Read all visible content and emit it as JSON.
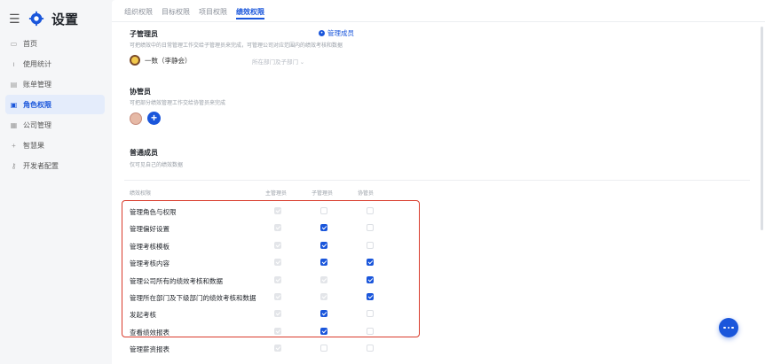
{
  "app": {
    "title": "设置"
  },
  "sidebar": {
    "items": [
      {
        "label": "首页",
        "icon": "home-icon"
      },
      {
        "label": "使用统计",
        "icon": "chart-icon"
      },
      {
        "label": "账单管理",
        "icon": "bill-icon"
      },
      {
        "label": "角色权限",
        "icon": "role-icon",
        "active": true
      },
      {
        "label": "公司管理",
        "icon": "company-icon"
      },
      {
        "label": "智慧果",
        "icon": "plus-icon"
      },
      {
        "label": "开发者配置",
        "icon": "key-icon"
      }
    ]
  },
  "tabs": [
    {
      "label": "组织权限"
    },
    {
      "label": "目标权限"
    },
    {
      "label": "项目权限"
    },
    {
      "label": "绩效权限",
      "active": true
    }
  ],
  "sub_admin": {
    "title": "子管理员",
    "desc": "可把绩效中的日常管理工作交给子管理员来完成，可管理公司对应范围内的绩效考核和数据",
    "manage_label": "管理成员",
    "member_name": "一数（李静会）",
    "scope_label": "所在部门及子部门 ⌄"
  },
  "assistant": {
    "title": "协管员",
    "desc": "可把部分绩效管理工作交给协管员来完成",
    "add_label": "+"
  },
  "normal": {
    "title": "普通成员",
    "desc": "仅可见自己的绩效数据"
  },
  "table": {
    "headers": [
      "绩效权限",
      "主管理员",
      "子管理员",
      "协管员"
    ],
    "rows": [
      {
        "label": "管理角色与权限",
        "main": "disabled",
        "sub": "off",
        "assist": "off"
      },
      {
        "label": "管理偏好设置",
        "main": "disabled",
        "sub": "on",
        "assist": "off"
      },
      {
        "label": "管理考核模板",
        "main": "disabled",
        "sub": "on",
        "assist": "off"
      },
      {
        "label": "管理考核内容",
        "main": "disabled",
        "sub": "on",
        "assist": "on"
      },
      {
        "label": "管理公司所有的绩效考核和数据",
        "main": "disabled",
        "sub": "disabled",
        "assist": "on"
      },
      {
        "label": "管理所在部门及下级部门的绩效考核和数据",
        "main": "disabled",
        "sub": "disabled",
        "assist": "on"
      },
      {
        "label": "发起考核",
        "main": "disabled",
        "sub": "on",
        "assist": "off"
      },
      {
        "label": "查看绩效报表",
        "main": "disabled",
        "sub": "on",
        "assist": "off"
      },
      {
        "label": "管理薪资报表",
        "main": "disabled",
        "sub": "off",
        "assist": "off"
      }
    ]
  },
  "colors": {
    "accent": "#1a56db",
    "highlight": "#d93b2b"
  }
}
